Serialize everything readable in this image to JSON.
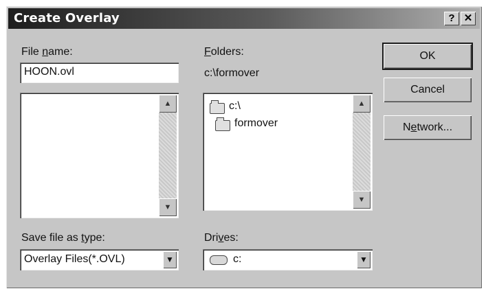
{
  "window": {
    "title": "Create Overlay",
    "help_glyph": "?",
    "close_glyph": "✕"
  },
  "file_name": {
    "label_pre": "File ",
    "label_access": "n",
    "label_post": "ame:",
    "value": "HOON.ovl",
    "files": []
  },
  "folders": {
    "label_access": "F",
    "label_post": "olders:",
    "current_path": "c:\\formover",
    "items": [
      "c:\\",
      "formover"
    ]
  },
  "save_type": {
    "label_pre": "Save file as ",
    "label_access": "t",
    "label_post": "ype:",
    "value": "Overlay Files(*.OVL)"
  },
  "drives": {
    "label_pre": "Dri",
    "label_access": "v",
    "label_post": "es:",
    "value": "c:"
  },
  "buttons": {
    "ok": "OK",
    "cancel": "Cancel",
    "network_pre": "N",
    "network_access": "e",
    "network_post": "twork..."
  },
  "glyphs": {
    "scroll_up": "▲",
    "scroll_down": "▼",
    "dropdown": "▼"
  },
  "icons": [
    "help-icon",
    "close-icon",
    "folder-open-icon",
    "folder-icon",
    "drive-icon",
    "scroll-up-arrow-icon",
    "scroll-down-arrow-icon",
    "dropdown-arrow-icon"
  ]
}
